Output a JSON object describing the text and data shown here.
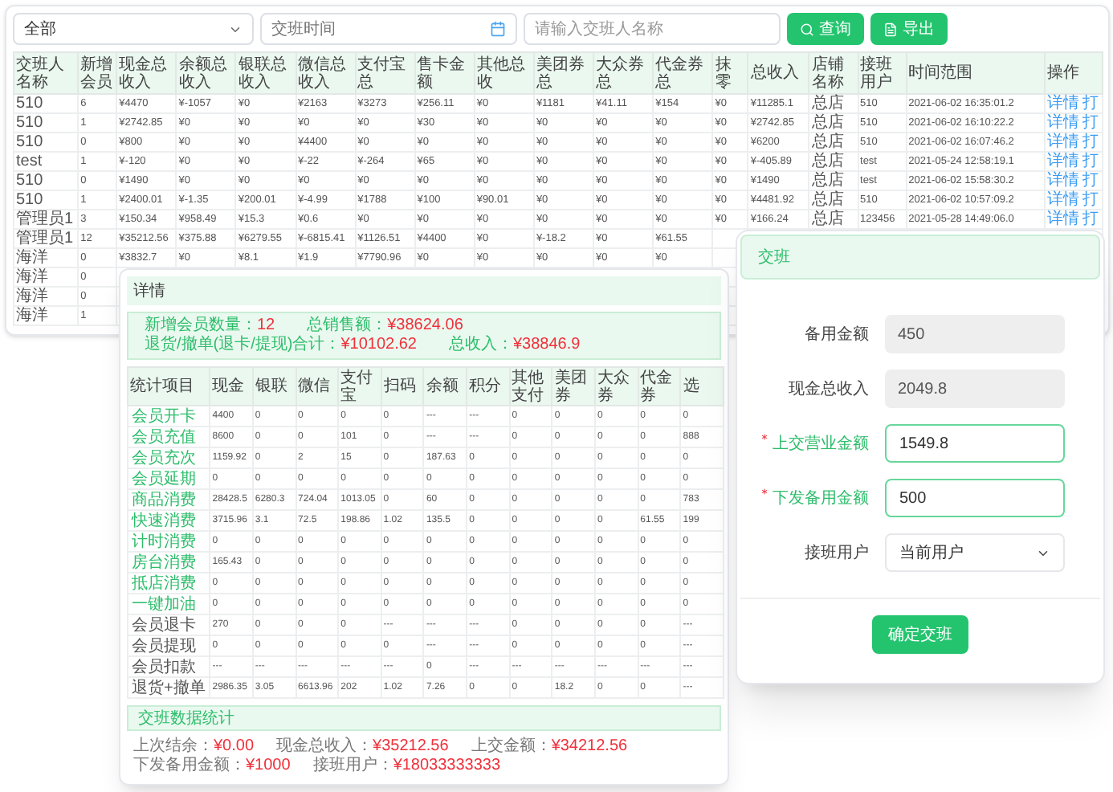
{
  "filters": {
    "scope": "全部",
    "date": {
      "placeholder": "交班时间"
    },
    "search": {
      "placeholder": "请输入交班人名称"
    },
    "buttons": [
      {
        "kind": "search",
        "label": "查询"
      },
      {
        "kind": "export",
        "label": "导出"
      }
    ]
  },
  "shift_table": {
    "columns": [
      "交班人名称",
      "新增会员",
      "现金总收入",
      "余额总收入",
      "银联总收入",
      "微信总收入",
      "支付宝总",
      "售卡金额",
      "其他总收",
      "美团券总",
      "大众券总",
      "代金券总",
      "抹零",
      "总收入",
      "店铺名称",
      "接班用户",
      "时间范围",
      "操作"
    ],
    "rows": [
      {
        "cells": [
          "510",
          "6",
          "¥4470",
          "¥-1057",
          "¥0",
          "¥2163",
          "¥3273",
          "¥256.11",
          "¥0",
          "¥1181",
          "¥41.11",
          "¥154",
          "¥0",
          "¥11285.1",
          "总店",
          "510",
          "2021-06-02 16:35:01.2"
        ],
        "actions": [
          "详情",
          "打"
        ]
      },
      {
        "cells": [
          "510",
          "1",
          "¥2742.85",
          "¥0",
          "¥0",
          "¥0",
          "¥0",
          "¥30",
          "¥0",
          "¥0",
          "¥0",
          "¥0",
          "¥0",
          "¥2742.85",
          "总店",
          "510",
          "2021-06-02 16:10:22.2"
        ],
        "actions": [
          "详情",
          "打"
        ]
      },
      {
        "cells": [
          "510",
          "0",
          "¥800",
          "¥0",
          "¥0",
          "¥4400",
          "¥0",
          "¥0",
          "¥0",
          "¥0",
          "¥0",
          "¥0",
          "¥0",
          "¥6200",
          "总店",
          "510",
          "2021-06-02 16:07:46.2"
        ],
        "actions": [
          "详情",
          "打"
        ]
      },
      {
        "cells": [
          "test",
          "1",
          "¥-120",
          "¥0",
          "¥0",
          "¥-22",
          "¥-264",
          "¥65",
          "¥0",
          "¥0",
          "¥0",
          "¥0",
          "¥0",
          "¥-405.89",
          "总店",
          "test",
          "2021-05-24 12:58:19.1"
        ],
        "actions": [
          "详情",
          "打"
        ]
      },
      {
        "cells": [
          "510",
          "0",
          "¥1490",
          "¥0",
          "¥0",
          "¥0",
          "¥0",
          "¥0",
          "¥0",
          "¥0",
          "¥0",
          "¥0",
          "¥0",
          "¥1490",
          "总店",
          "test",
          "2021-06-02 15:58:30.2"
        ],
        "actions": [
          "详情",
          "打"
        ]
      },
      {
        "cells": [
          "510",
          "1",
          "¥2400.01",
          "¥-1.35",
          "¥200.01",
          "¥-4.99",
          "¥1788",
          "¥100",
          "¥90.01",
          "¥0",
          "¥0",
          "¥0",
          "¥0",
          "¥4481.92",
          "总店",
          "510",
          "2021-06-02 10:57:09.2"
        ],
        "actions": [
          "详情",
          "打"
        ]
      },
      {
        "cells": [
          "管理员1",
          "3",
          "¥150.34",
          "¥958.49",
          "¥15.3",
          "¥0.6",
          "¥0",
          "¥0",
          "¥0",
          "¥0",
          "¥0",
          "¥0",
          "¥0",
          "¥166.24",
          "总店",
          "123456",
          "2021-05-28 14:49:06.0"
        ],
        "actions": [
          "详情",
          "打"
        ]
      },
      {
        "cells": [
          "管理员1",
          "12",
          "¥35212.56",
          "¥375.88",
          "¥6279.55",
          "¥-6815.41",
          "¥1126.51",
          "¥4400",
          "¥0",
          "¥-18.2",
          "¥0",
          "¥61.55"
        ]
      },
      {
        "cells": [
          "海洋",
          "0",
          "¥3832.7",
          "¥0",
          "¥8.1",
          "¥1.9",
          "¥7790.96",
          "¥0",
          "¥0",
          "¥0",
          "¥0",
          "¥0"
        ]
      },
      {
        "cells": [
          "海洋",
          "0"
        ]
      },
      {
        "cells": [
          "海洋",
          "0"
        ]
      },
      {
        "cells": [
          "海洋",
          "1"
        ]
      }
    ]
  },
  "detail": {
    "title": "详情",
    "summary": [
      {
        "label": "新增会员数量：",
        "value": "12"
      },
      {
        "label": "总销售额：",
        "value": "¥38624.06"
      },
      {
        "label": "退货/撤单(退卡/提现)合计：",
        "value": "¥10102.62"
      },
      {
        "label": "总收入：",
        "value": "¥38846.9"
      }
    ],
    "table": {
      "columns": [
        "统计项目",
        "现金",
        "银联",
        "微信",
        "支付宝",
        "扫码",
        "余额",
        "积分",
        "其他支付",
        "美团券",
        "大众券",
        "代金券",
        "选"
      ],
      "rows": [
        {
          "kind": "income",
          "cells": [
            "会员开卡",
            "4400",
            "0",
            "0",
            "0",
            "0",
            "---",
            "---",
            "0",
            "0",
            "0",
            "0",
            "0"
          ]
        },
        {
          "kind": "income",
          "cells": [
            "会员充值",
            "8600",
            "0",
            "0",
            "101",
            "0",
            "---",
            "---",
            "0",
            "0",
            "0",
            "0",
            "888"
          ]
        },
        {
          "kind": "income",
          "cells": [
            "会员充次",
            "1159.92",
            "0",
            "2",
            "15",
            "0",
            "187.63",
            "0",
            "0",
            "0",
            "0",
            "0",
            "0"
          ]
        },
        {
          "kind": "income",
          "cells": [
            "会员延期",
            "0",
            "0",
            "0",
            "0",
            "0",
            "0",
            "0",
            "0",
            "0",
            "0",
            "0",
            "0"
          ]
        },
        {
          "kind": "income",
          "cells": [
            "商品消费",
            "28428.5",
            "6280.3",
            "724.04",
            "1013.05",
            "0",
            "60",
            "0",
            "0",
            "0",
            "0",
            "0",
            "783"
          ]
        },
        {
          "kind": "income",
          "cells": [
            "快速消费",
            "3715.96",
            "3.1",
            "72.5",
            "198.86",
            "1.02",
            "135.5",
            "0",
            "0",
            "0",
            "0",
            "61.55",
            "199"
          ]
        },
        {
          "kind": "income",
          "cells": [
            "计时消费",
            "0",
            "0",
            "0",
            "0",
            "0",
            "0",
            "0",
            "0",
            "0",
            "0",
            "0",
            "0"
          ]
        },
        {
          "kind": "income",
          "cells": [
            "房台消费",
            "165.43",
            "0",
            "0",
            "0",
            "0",
            "0",
            "0",
            "0",
            "0",
            "0",
            "0",
            "0"
          ]
        },
        {
          "kind": "income",
          "cells": [
            "抵店消费",
            "0",
            "0",
            "0",
            "0",
            "0",
            "0",
            "0",
            "0",
            "0",
            "0",
            "0",
            "0"
          ]
        },
        {
          "kind": "income",
          "cells": [
            "一键加油",
            "0",
            "0",
            "0",
            "0",
            "0",
            "0",
            "0",
            "0",
            "0",
            "0",
            "0",
            "0"
          ]
        },
        {
          "kind": "refund",
          "cells": [
            "会员退卡",
            "270",
            "0",
            "0",
            "0",
            "---",
            "---",
            "---",
            "0",
            "0",
            "0",
            "0",
            "---"
          ]
        },
        {
          "kind": "refund",
          "cells": [
            "会员提现",
            "0",
            "0",
            "0",
            "0",
            "0",
            "---",
            "---",
            "0",
            "0",
            "0",
            "0",
            "---"
          ]
        },
        {
          "kind": "refund",
          "cells": [
            "会员扣款",
            "---",
            "---",
            "---",
            "---",
            "---",
            "0",
            "---",
            "---",
            "---",
            "---",
            "---",
            "---"
          ]
        },
        {
          "kind": "refund",
          "cells": [
            "退货+撤单",
            "2986.35",
            "3.05",
            "6613.96",
            "202",
            "1.02",
            "7.26",
            "0",
            "0",
            "18.2",
            "0",
            "0",
            "---"
          ]
        }
      ]
    },
    "section": "交班数据统计",
    "stats": [
      {
        "label": "上次结余：",
        "value": "¥0.00"
      },
      {
        "label": "现金总收入：",
        "value": "¥35212.56"
      },
      {
        "label": "上交金额：",
        "value": "¥34212.56"
      },
      {
        "label": "下发备用金额：",
        "value": "¥1000"
      },
      {
        "label": "接班用户：",
        "value": "¥18033333333"
      }
    ]
  },
  "handover_dialog": {
    "title": "交班",
    "fields": [
      {
        "label": "备用金额",
        "value": "450",
        "kind": "readonly",
        "required": false
      },
      {
        "label": "现金总收入",
        "value": "2049.8",
        "kind": "readonly",
        "required": false
      },
      {
        "label": "上交营业金额",
        "value": "1549.8",
        "kind": "input",
        "required": true
      },
      {
        "label": "下发备用金额",
        "value": "500",
        "kind": "input",
        "required": true
      },
      {
        "label": "接班用户",
        "value": "当前用户",
        "kind": "select",
        "required": false
      }
    ],
    "button": "确定交班"
  }
}
